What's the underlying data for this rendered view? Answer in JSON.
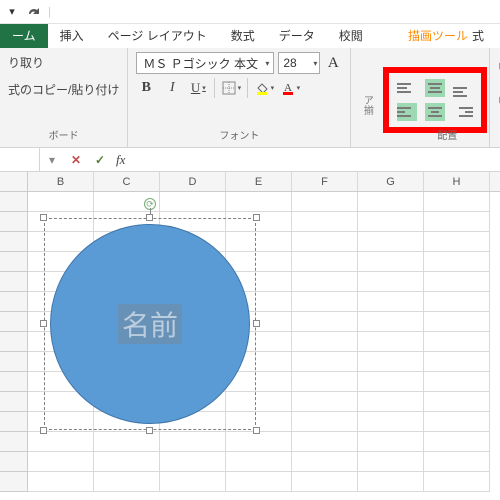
{
  "qat": {
    "dropdown_glyph": "▾"
  },
  "tool_context": {
    "title": "描画ツール"
  },
  "tabs": {
    "home": "ーム",
    "insert": "挿入",
    "pagelayout": "ページ レイアウト",
    "formulas": "数式",
    "data": "データ",
    "review": "校閲",
    "format_cut": "式"
  },
  "clipboard": {
    "cut": "り取り",
    "copy_paste": "式のコピー/貼り付け",
    "group_label": "ボード"
  },
  "font": {
    "name": "ＭＳ Ｐゴシック 本文",
    "size": "28",
    "grow_glyph": "A",
    "bold": "B",
    "italic": "I",
    "underline": "U",
    "group_label": "フォント"
  },
  "vertical": {
    "label": "ア揃"
  },
  "alignment": {
    "group_label": "配置"
  },
  "fx": {
    "label": "fx"
  },
  "columns": [
    "B",
    "C",
    "D",
    "E",
    "F",
    "G",
    "H"
  ],
  "shape": {
    "text": "名前"
  }
}
